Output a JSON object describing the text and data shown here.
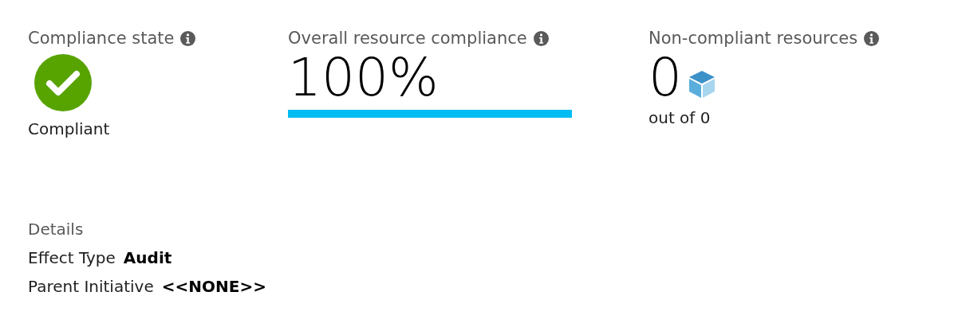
{
  "tiles": [
    {
      "kind": "state",
      "title": "Compliance state",
      "compliant": true,
      "value": "Compliant"
    },
    {
      "kind": "percent",
      "title": "Overall resource compliance",
      "value": "100%"
    },
    {
      "kind": "count",
      "title": "Non-compliant resources",
      "value": "0",
      "total": "out of 0"
    }
  ],
  "details": {
    "heading": "Details",
    "rows": [
      {
        "label": "Effect Type",
        "value": "Audit"
      },
      {
        "label": "Parent Initiative",
        "value": "<<NONE>>"
      }
    ]
  }
}
